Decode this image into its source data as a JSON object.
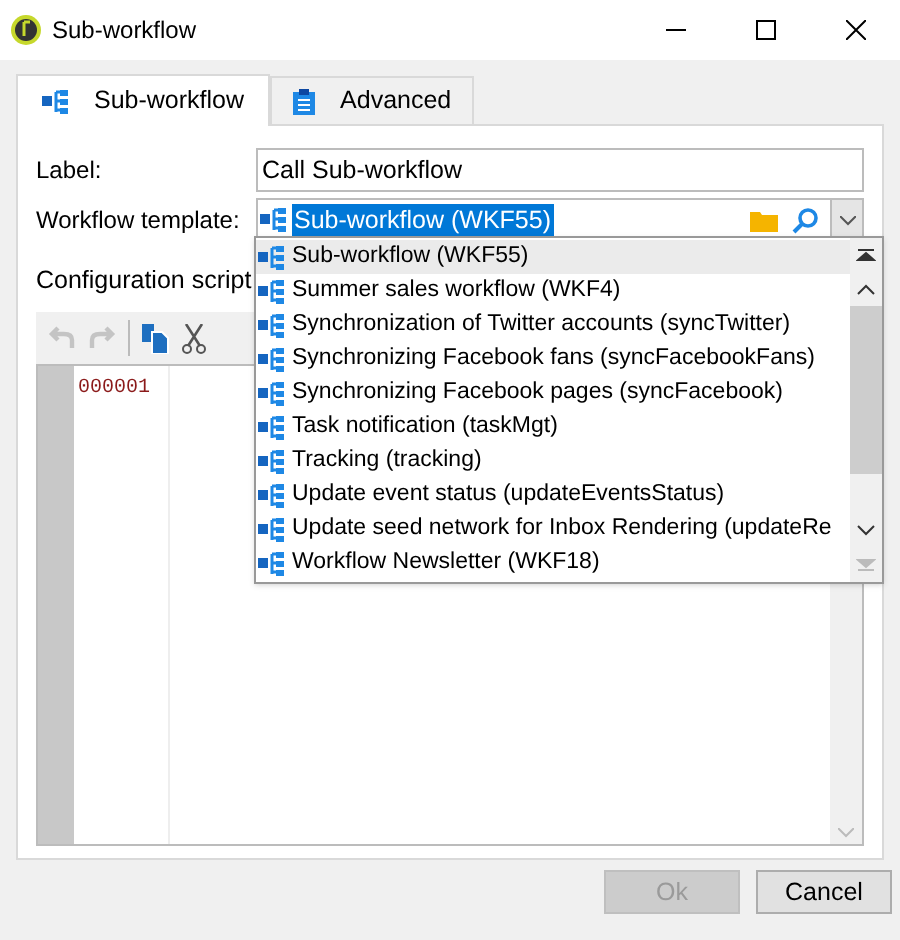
{
  "window": {
    "title": "Sub-workflow"
  },
  "tabs": [
    {
      "label": "Sub-workflow",
      "selected": true,
      "kind": "workflow"
    },
    {
      "label": "Advanced",
      "selected": false,
      "kind": "clipboard"
    }
  ],
  "label_field": {
    "caption": "Label:",
    "value": "Call Sub-workflow"
  },
  "template_field": {
    "caption": "Workflow template:",
    "value": "Sub-workflow (WKF55)"
  },
  "dropdown": {
    "items": [
      {
        "label": "Sub-workflow (WKF55)",
        "selected": true
      },
      {
        "label": "Summer sales workflow (WKF4)",
        "selected": false
      },
      {
        "label": "Synchronization of Twitter accounts (syncTwitter)",
        "selected": false
      },
      {
        "label": "Synchronizing Facebook fans (syncFacebookFans)",
        "selected": false
      },
      {
        "label": "Synchronizing Facebook pages (syncFacebook)",
        "selected": false
      },
      {
        "label": "Task notification (taskMgt)",
        "selected": false
      },
      {
        "label": "Tracking (tracking)",
        "selected": false
      },
      {
        "label": "Update event status (updateEventsStatus)",
        "selected": false
      },
      {
        "label": "Update seed network for Inbox Rendering (updateRe",
        "selected": false
      },
      {
        "label": "Workflow Newsletter (WKF18)",
        "selected": false
      }
    ]
  },
  "config": {
    "caption": "Configuration script",
    "line_numbers": [
      "000001"
    ]
  },
  "toolbar": [
    {
      "kind": "undo",
      "disabled": true
    },
    {
      "kind": "redo",
      "disabled": true
    },
    {
      "kind": "copy",
      "disabled": false
    },
    {
      "kind": "cut",
      "disabled": false
    }
  ],
  "buttons": [
    {
      "label": "Ok",
      "disabled": true
    },
    {
      "label": "Cancel",
      "disabled": false
    }
  ]
}
